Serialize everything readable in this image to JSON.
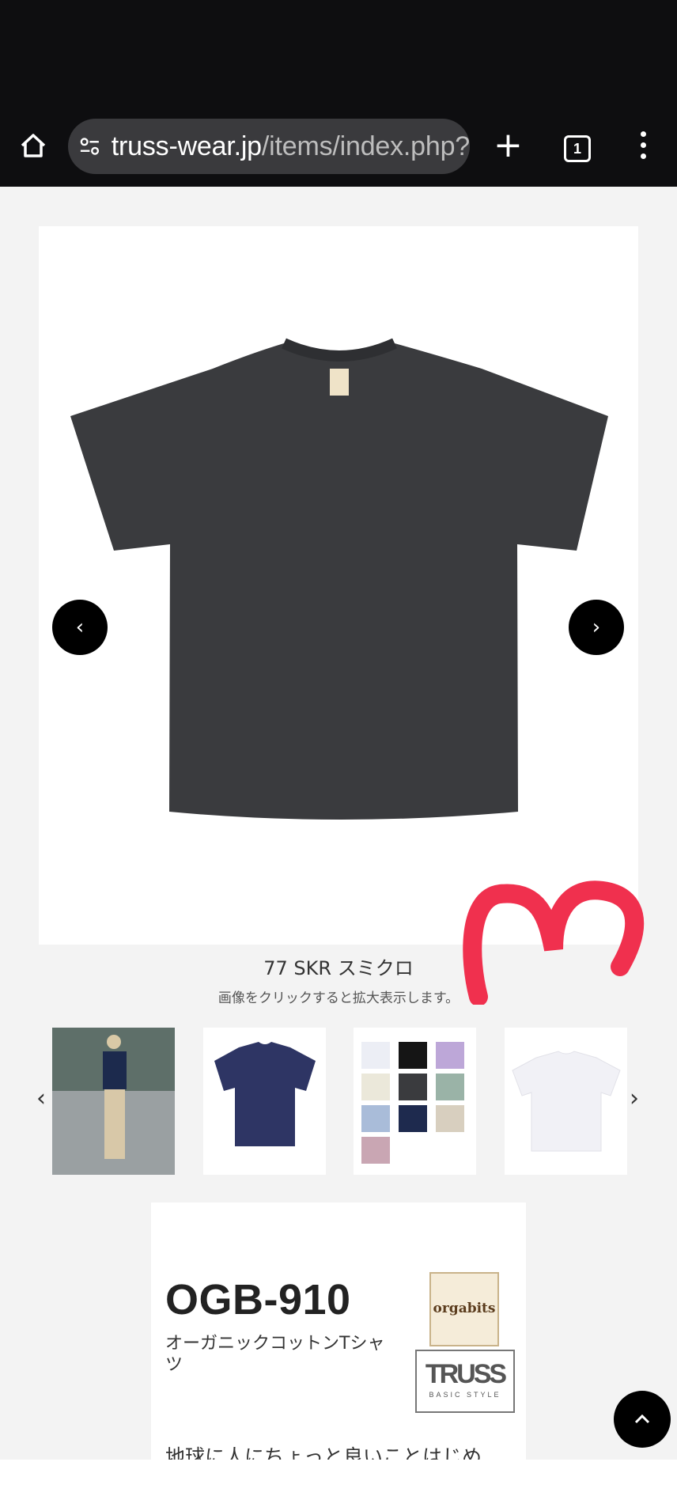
{
  "browser": {
    "url_host": "truss-wear.jp",
    "url_path": "/items/index.php?",
    "tab_count": "1",
    "plus_label": "+"
  },
  "gallery": {
    "prev_label": "‹",
    "next_label": "›",
    "color_name": "77 SKR スミクロ",
    "hint": "画像をクリックすると拡大表示します。"
  },
  "thumbnails": {
    "prev_label": "‹",
    "next_label": "›"
  },
  "product": {
    "model": "OGB-910",
    "name": "オーガニックコットンTシャツ",
    "description": "地球に人にちょっと良いことはじめ",
    "brand_logo_text": "orgabits",
    "truss_logo_text": "TRUSS",
    "truss_logo_sub": "BASIC STYLE"
  },
  "colors": {
    "shirt": "#3a3b3e",
    "scribble": "#f0304e"
  }
}
